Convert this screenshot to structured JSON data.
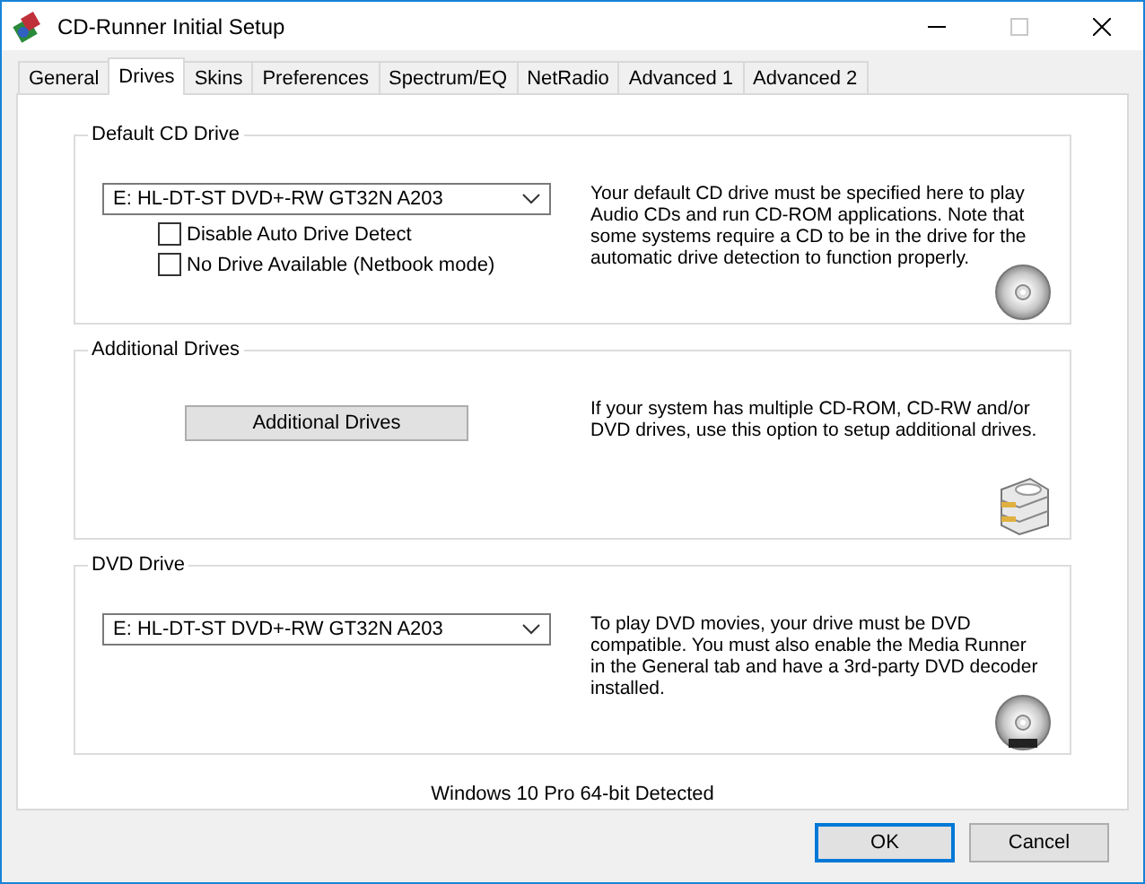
{
  "window": {
    "title": "CD-Runner Initial Setup",
    "maximize_disabled": true
  },
  "tabs": [
    {
      "label": "General",
      "selected": false
    },
    {
      "label": "Drives",
      "selected": true
    },
    {
      "label": "Skins",
      "selected": false
    },
    {
      "label": "Preferences",
      "selected": false
    },
    {
      "label": "Spectrum/EQ",
      "selected": false
    },
    {
      "label": "NetRadio",
      "selected": false
    },
    {
      "label": "Advanced 1",
      "selected": false
    },
    {
      "label": "Advanced 2",
      "selected": false
    }
  ],
  "groups": [
    {
      "kind": "select",
      "title": "Default CD Drive",
      "value": "E: HL-DT-ST DVD+-RW GT32N A203",
      "options": [
        {
          "label": "Disable Auto Drive Detect",
          "checked": false
        },
        {
          "label": "No Drive Available (Netbook mode)",
          "checked": false
        }
      ],
      "description": "Your default CD drive must be specified here to play Audio CDs and run CD-ROM applications. Note that some systems require a CD to be in the drive for the automatic drive detection to function properly."
    },
    {
      "kind": "button",
      "title": "Additional Drives",
      "button": "Additional Drives",
      "description": "If your system has multiple CD-ROM, CD-RW and/or DVD drives, use this option to setup additional drives."
    },
    {
      "kind": "select",
      "title": "DVD Drive",
      "value": "E: HL-DT-ST DVD+-RW GT32N A203",
      "description": "To play DVD movies, your drive must be DVD compatible. You must also enable the Media Runner in the General tab and have a 3rd-party DVD decoder installed."
    }
  ],
  "status": "Windows 10 Pro 64-bit Detected",
  "buttons": [
    {
      "label": "OK",
      "default": true
    },
    {
      "label": "Cancel",
      "default": false
    }
  ]
}
